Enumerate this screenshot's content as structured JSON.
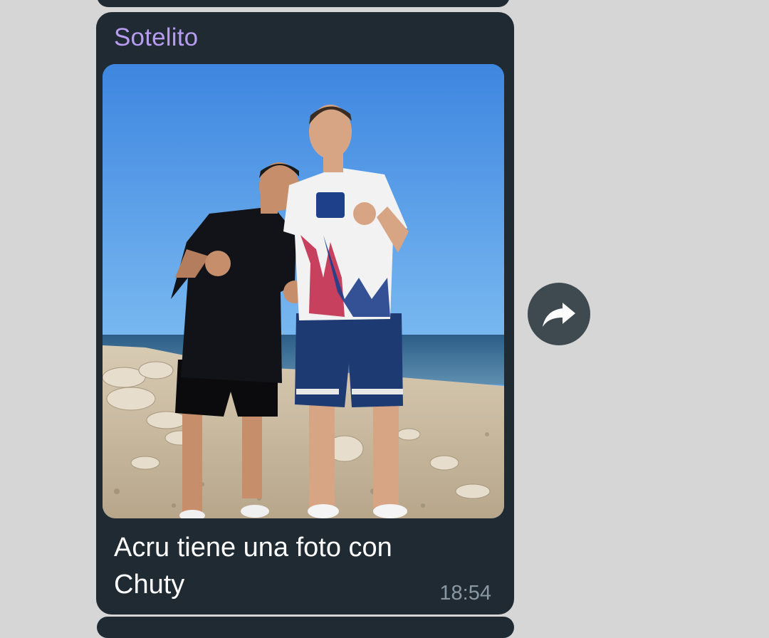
{
  "message": {
    "sender_name": "Sotelito",
    "caption": "Acru tiene una foto con Chuty",
    "time": "18:54"
  },
  "photo": {
    "description_icon": "photo-image"
  },
  "actions": {
    "share_icon": "share-arrow-icon"
  },
  "colors": {
    "background": "#d6d6d6",
    "bubble": "#1f2a33",
    "sender": "#b79cf2",
    "caption": "#ffffff",
    "time": "#8a98a3",
    "share_button": "#3f4a50"
  }
}
